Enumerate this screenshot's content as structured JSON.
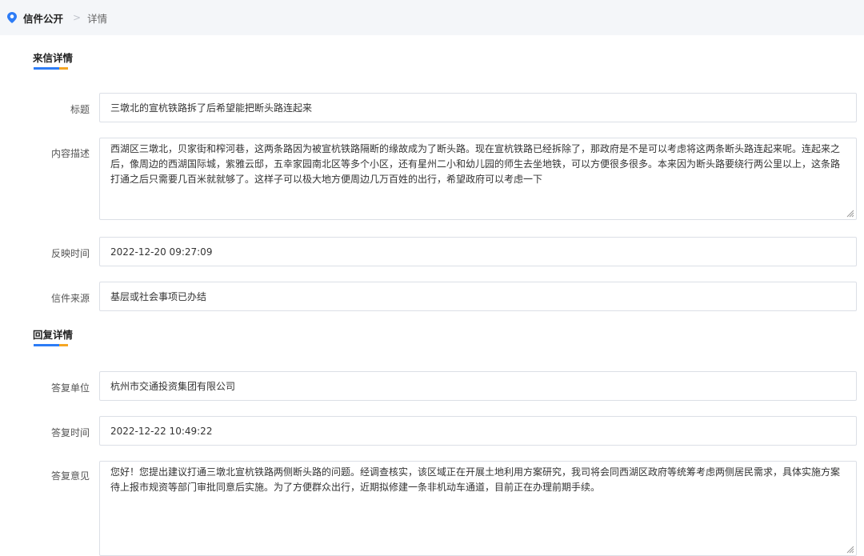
{
  "breadcrumb": {
    "main": "信件公开",
    "separator": ">",
    "current": "详情"
  },
  "letter_section": {
    "title": "来信详情",
    "fields": {
      "title": {
        "label": "标题",
        "value": "三墩北的宣杭铁路拆了后希望能把断头路连起来"
      },
      "description": {
        "label": "内容描述",
        "value": "西湖区三墩北，贝家街和榨河巷，这两条路因为被宣杭铁路隔断的缘故成为了断头路。现在宣杭铁路已经拆除了，那政府是不是可以考虑将这两条断头路连起来呢。连起来之后，像周边的西湖国际城，紫雅云邸，五幸家园南北区等多个小区，还有星州二小和幼儿园的师生去坐地铁，可以方便很多很多。本来因为断头路要绕行两公里以上，这条路打通之后只需要几百米就就够了。这样子可以极大地方便周边几万百姓的出行，希望政府可以考虑一下"
      },
      "submit_time": {
        "label": "反映时间",
        "value": "2022-12-20 09:27:09"
      },
      "source": {
        "label": "信件来源",
        "value": "基层或社会事项已办结"
      }
    }
  },
  "reply_section": {
    "title": "回复详情",
    "fields": {
      "unit": {
        "label": "答复单位",
        "value": "杭州市交通投资集团有限公司"
      },
      "reply_time": {
        "label": "答复时间",
        "value": "2022-12-22 10:49:22"
      },
      "opinion": {
        "label": "答复意见",
        "value": "您好！您提出建议打通三墩北宣杭铁路两侧断头路的问题。经调查核实，该区域正在开展土地利用方案研究，我司将会同西湖区政府等统筹考虑两侧居民需求，具体实施方案待上报市规资等部门审批同意后实施。为了方便群众出行，近期拟修建一条非机动车通道，目前正在办理前期手续。"
      }
    }
  },
  "icons": {
    "location": "map-pin-icon",
    "resize": "resize-handle-icon"
  },
  "colors": {
    "accent_blue": "#2d7cf6",
    "accent_orange": "#f5a623",
    "border": "#dcdfe6",
    "topbar_bg": "#f4f6f9"
  }
}
